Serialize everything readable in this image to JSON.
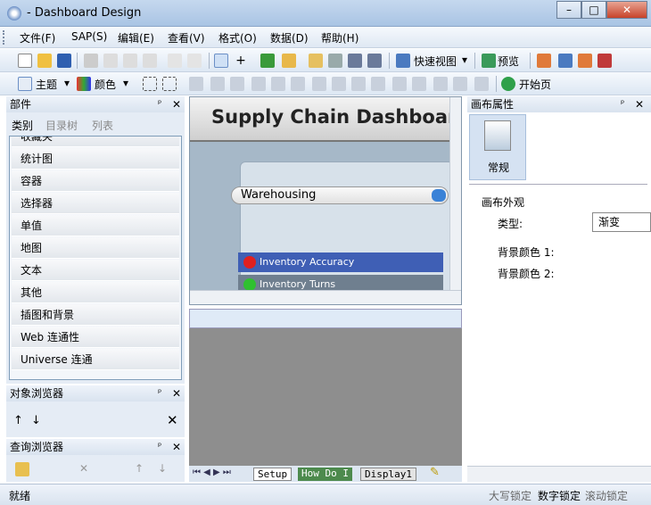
{
  "window": {
    "title": "- Dashboard Design",
    "minimize": "–",
    "maximize": "□",
    "close": "✕"
  },
  "menu": [
    "文件(F)",
    "SAP(S)",
    "编辑(E)",
    "查看(V)",
    "格式(O)",
    "数据(D)",
    "帮助(H)"
  ],
  "toolbar1": {
    "quick_view": "快速视图",
    "preview": "预览"
  },
  "toolbar2": {
    "theme": "主题",
    "color": "颜色",
    "start_page": "开始页"
  },
  "components": {
    "title": "部件",
    "tabs": [
      "类别",
      "目录树",
      "列表"
    ],
    "items": [
      "收藏夹",
      "统计图",
      "容器",
      "选择器",
      "单值",
      "地图",
      "文本",
      "其他",
      "插图和背景",
      "Web 连通性",
      "Universe 连通"
    ]
  },
  "canvas": {
    "dash_title": "Supply Chain Dashboard",
    "dropdown_value": "Warehousing",
    "rows": [
      {
        "label": "Inventory Accuracy",
        "status_color": "#e02020",
        "row_color": "#3f5fb5"
      },
      {
        "label": "Inventory Turns",
        "status_color": "#30c030",
        "row_color": "#6f7f8f"
      }
    ]
  },
  "sheets": [
    "Setup",
    "How Do I",
    "Display1"
  ],
  "canvas_props": {
    "title": "画布属性",
    "category": "常规",
    "section": "画布外观",
    "type_label": "类型:",
    "type_value": "渐变",
    "bg1": "背景颜色 1:",
    "bg2": "背景颜色 2:"
  },
  "object_browser": {
    "title": "对象浏览器"
  },
  "query_browser": {
    "title": "查询浏览器"
  },
  "status": {
    "ready": "就绪",
    "caps": "大写锁定",
    "num": "数字锁定",
    "scroll": "滚动锁定"
  }
}
